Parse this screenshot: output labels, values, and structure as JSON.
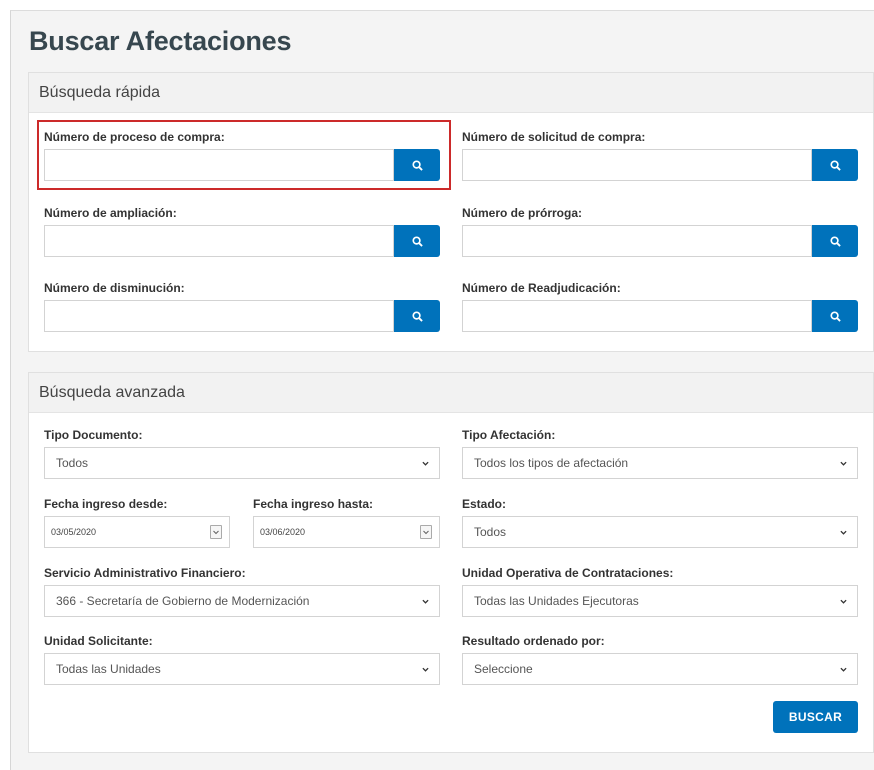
{
  "page": {
    "title": "Buscar Afectaciones"
  },
  "quick_search": {
    "title": "Búsqueda rápida",
    "fields": [
      {
        "label": "Número de proceso de compra:",
        "value": ""
      },
      {
        "label": "Número de solicitud de compra:",
        "value": ""
      },
      {
        "label": "Número de ampliación:",
        "value": ""
      },
      {
        "label": "Número de prórroga:",
        "value": ""
      },
      {
        "label": "Número de disminución:",
        "value": ""
      },
      {
        "label": "Número de Readjudicación:",
        "value": ""
      }
    ],
    "search_icon": "search-icon",
    "highlight_color": "#cc2a2a"
  },
  "advanced_search": {
    "title": "Búsqueda avanzada",
    "tipo_documento": {
      "label": "Tipo Documento:",
      "value": "Todos"
    },
    "tipo_afectacion": {
      "label": "Tipo Afectación:",
      "value": "Todos los tipos de afectación"
    },
    "fecha_desde": {
      "label": "Fecha ingreso desde:",
      "value": "03/05/2020"
    },
    "fecha_hasta": {
      "label": "Fecha ingreso hasta:",
      "value": "03/06/2020"
    },
    "estado": {
      "label": "Estado:",
      "value": "Todos"
    },
    "saf": {
      "label": "Servicio Administrativo Financiero:",
      "value": "366 - Secretaría de Gobierno de Modernización"
    },
    "uoc": {
      "label": "Unidad Operativa de Contrataciones:",
      "value": "Todas las Unidades Ejecutoras"
    },
    "unidad_solicitante": {
      "label": "Unidad Solicitante:",
      "value": "Todas las Unidades"
    },
    "ordenado_por": {
      "label": "Resultado ordenado por:",
      "value": "Seleccione"
    },
    "buscar_label": "BUSCAR"
  },
  "colors": {
    "primary": "#0072bb",
    "title": "#37474f"
  }
}
